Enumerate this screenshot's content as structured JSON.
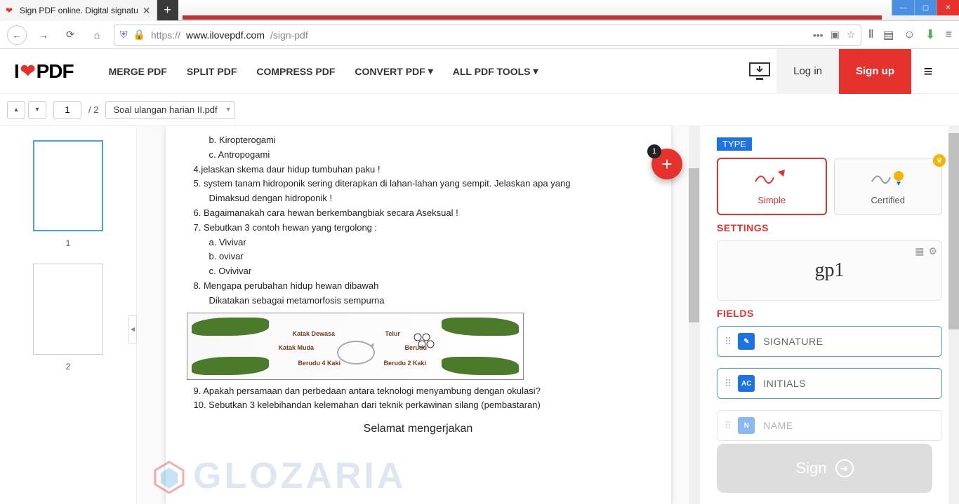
{
  "browser": {
    "tab_title": "Sign PDF online. Digital signatu",
    "url_proto": "https://",
    "url_domain": "www.ilovepdf.com",
    "url_path": "/sign-pdf"
  },
  "header": {
    "logo_pre": "I",
    "logo_post": "PDF",
    "nav": [
      "MERGE PDF",
      "SPLIT PDF",
      "COMPRESS PDF",
      "CONVERT PDF",
      "ALL PDF TOOLS"
    ],
    "login": "Log in",
    "signup": "Sign up"
  },
  "toolbar": {
    "page_current": "1",
    "page_total": "/ 2",
    "filename": "Soal ulangan harian II.pdf"
  },
  "thumbs": {
    "p1": "1",
    "p2": "2"
  },
  "fab_badge": "1",
  "document": {
    "lines": [
      "b. Kiropterogami",
      "c. Antropogami",
      "4.jelaskan  skema daur hidup tumbuhan paku !",
      "5. system tanam hidroponik sering diterapkan di lahan-lahan yang sempit. Jelaskan apa yang",
      "Dimaksud dengan hidroponik !",
      "6. Bagaimanakah cara hewan berkembangbiak secara Aseksual !",
      "7. Sebutkan 3 contoh hewan yang tergolong :",
      "a. Vivivar",
      "b. ovivar",
      "c. Ovivivar",
      "8. Mengapa perubahan hidup hewan dibawah",
      "Dikatakan sebagai metamorfosis sempurna"
    ],
    "after_diagram": [
      "9. Apakah persamaan dan perbedaan antara teknologi menyambung dengan okulasi?",
      "10. Sebutkan 3 kelebihandan kelemahan dari teknik perkawinan silang (pembastaran)"
    ],
    "footer": "Selamat mengerjakan",
    "diagram_labels": [
      "Katak Dewasa",
      "Telur",
      "Katak Muda",
      "Berudu",
      "Berudu 4 Kaki",
      "Berudu 2 Kaki"
    ]
  },
  "watermark": "GLOZARIA",
  "panel": {
    "type_label": "TYPE",
    "simple": "Simple",
    "certified": "Certified",
    "settings_label": "SETTINGS",
    "signature_preview": "gp1",
    "fields_label": "FIELDS",
    "f_signature": "SIGNATURE",
    "f_initials_icon": "AC",
    "f_initials": "INITIALS",
    "f_name": "NAME",
    "sign_button": "Sign"
  }
}
